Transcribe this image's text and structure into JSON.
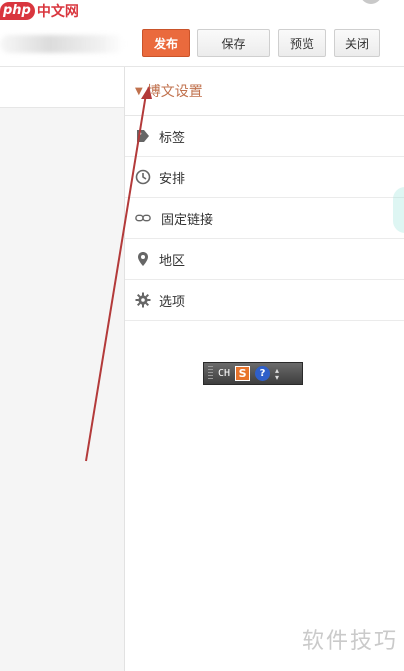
{
  "logo": {
    "php": "php",
    "site": "中文网"
  },
  "toolbar": {
    "publish_label": "发布",
    "save_label": "保存",
    "preview_label": "预览",
    "close_label": "关闭"
  },
  "sidebar": {
    "header_label": "博文设置",
    "items": [
      {
        "label": "标签",
        "icon": "tag-icon"
      },
      {
        "label": "安排",
        "icon": "clock-icon"
      },
      {
        "label": "固定链接",
        "icon": "link-icon"
      },
      {
        "label": "地区",
        "icon": "map-pin-icon"
      },
      {
        "label": "选项",
        "icon": "gear-icon"
      }
    ]
  },
  "ime": {
    "mode": "CH",
    "logo": "S",
    "help": "?"
  },
  "watermark": "软件技巧",
  "colors": {
    "accent": "#ea6a3d",
    "header_text": "#c0714d",
    "arrow": "#b33a3a",
    "brand": "#d9363e"
  }
}
